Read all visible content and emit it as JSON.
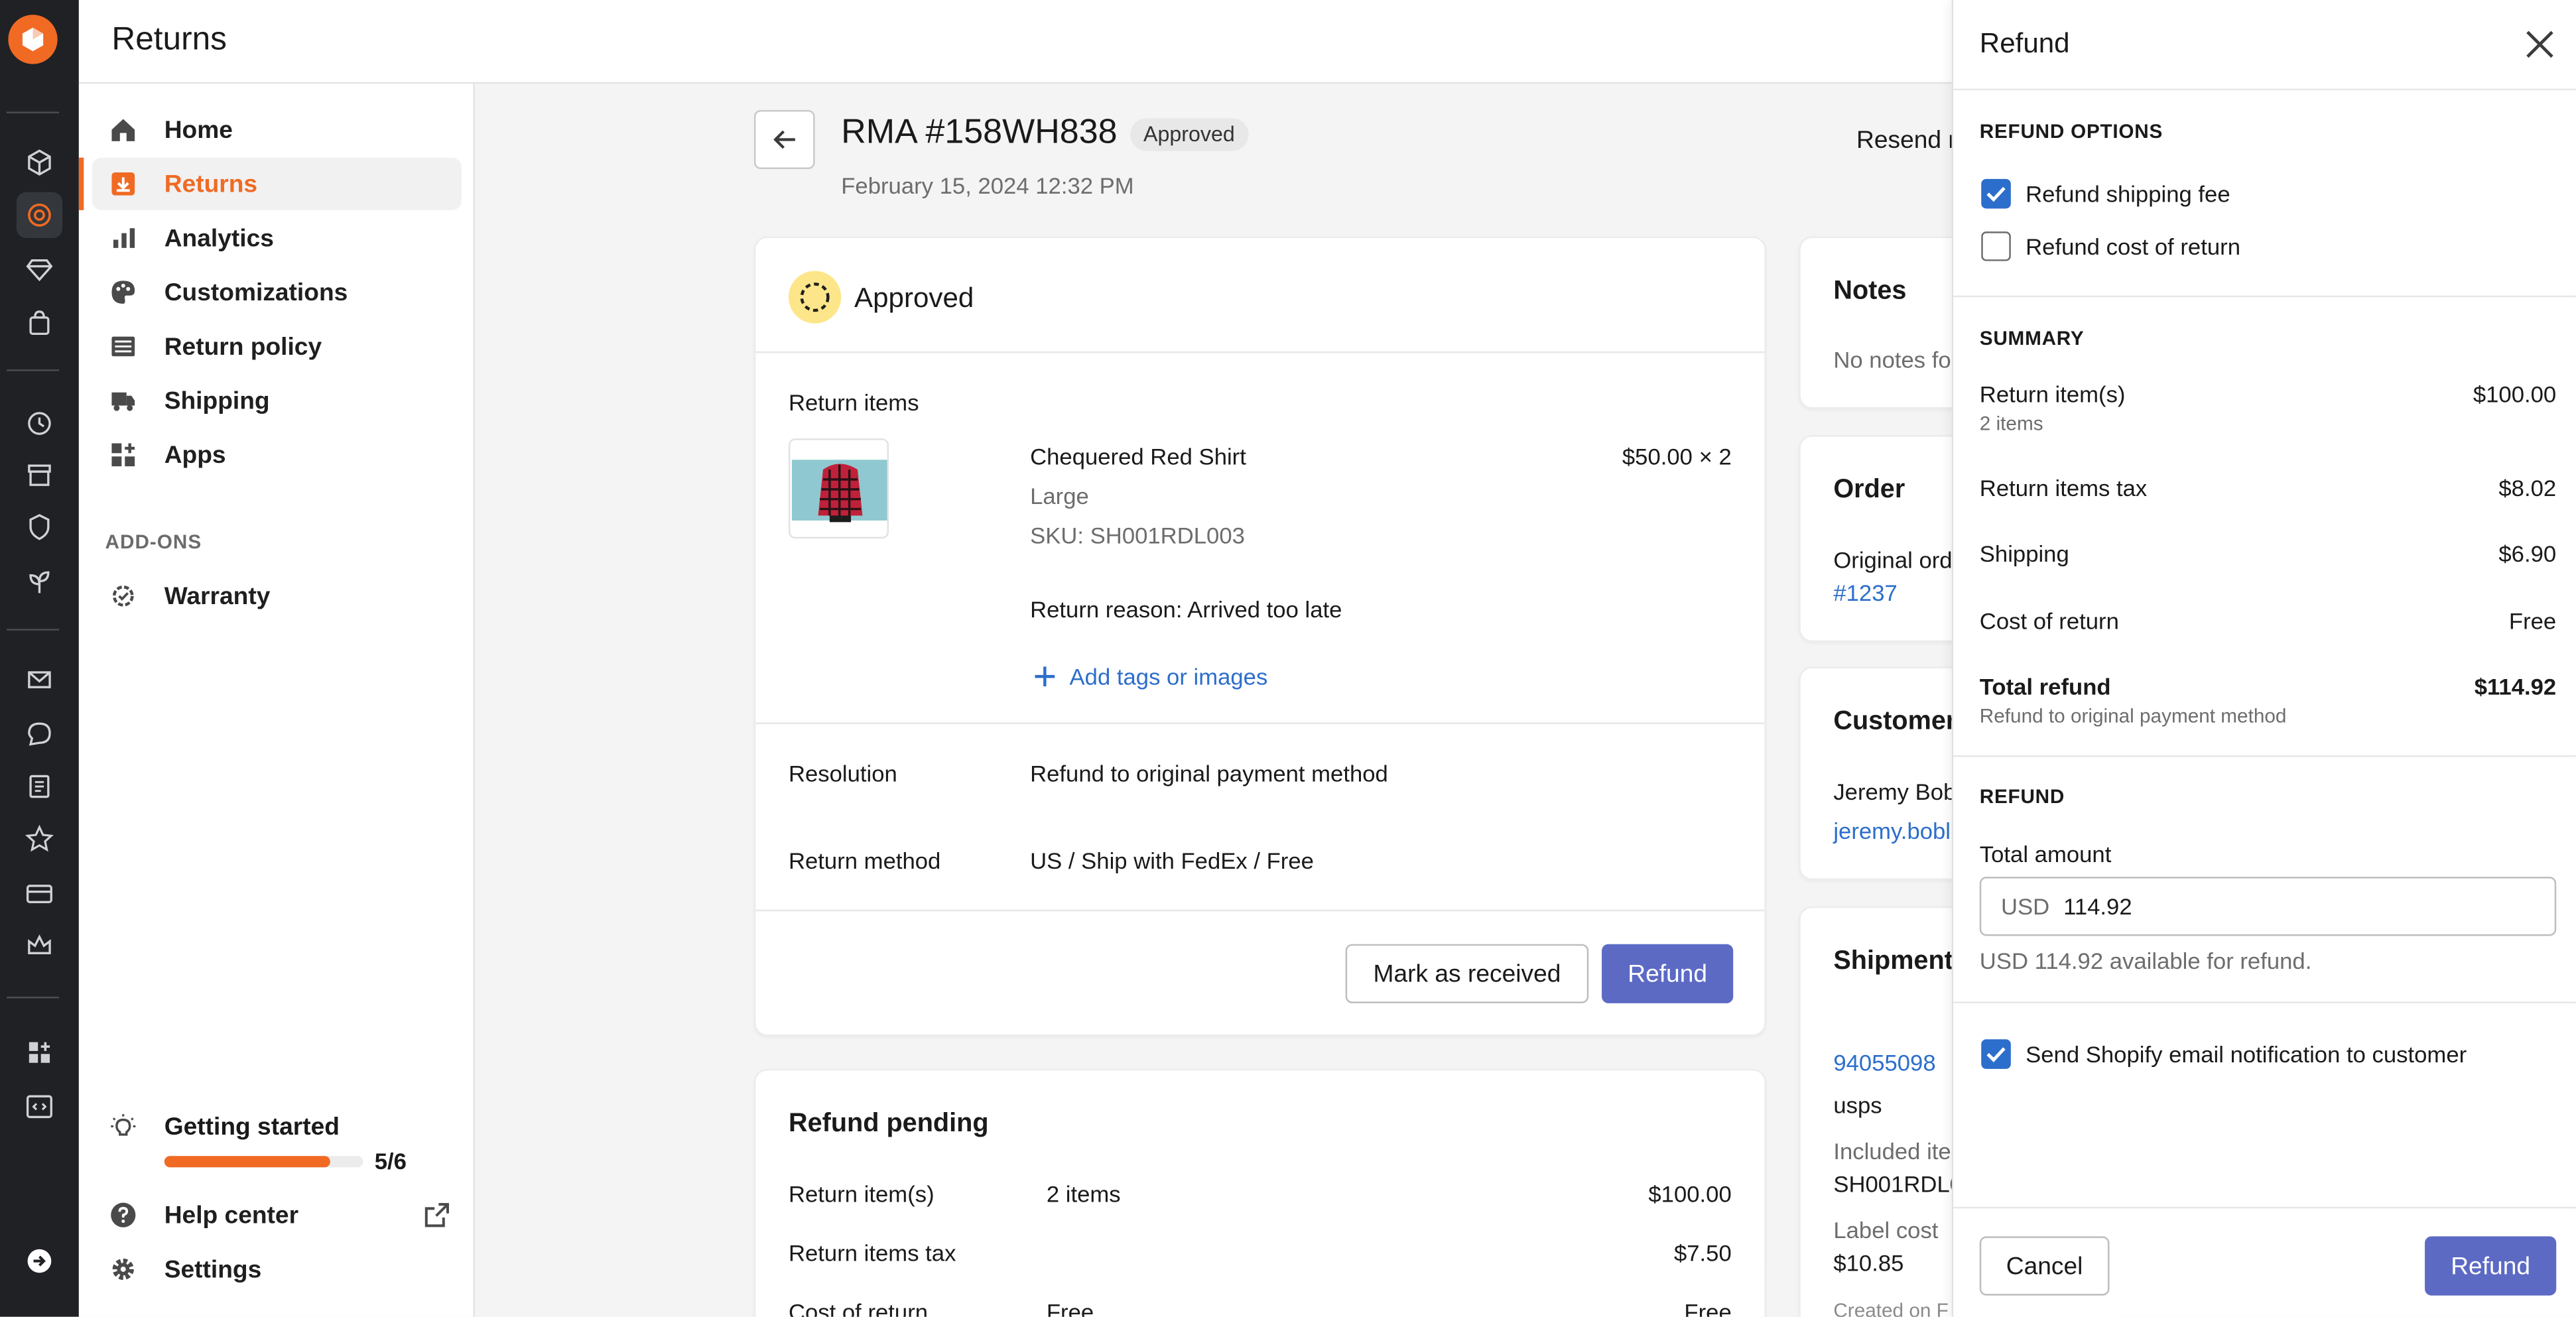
{
  "app": {
    "title": "Returns"
  },
  "sidebar": {
    "items": [
      {
        "label": "Home",
        "icon": "home-icon"
      },
      {
        "label": "Returns",
        "icon": "returns-icon",
        "active": true
      },
      {
        "label": "Analytics",
        "icon": "bar-chart-icon"
      },
      {
        "label": "Customizations",
        "icon": "palette-icon"
      },
      {
        "label": "Return policy",
        "icon": "list-icon"
      },
      {
        "label": "Shipping",
        "icon": "truck-icon"
      },
      {
        "label": "Apps",
        "icon": "apps-icon"
      }
    ],
    "addons_heading": "ADD-ONS",
    "addons": [
      {
        "label": "Warranty",
        "icon": "gear-badge-icon"
      }
    ],
    "getting_started": {
      "label": "Getting started",
      "progress": "5/6",
      "fraction": 0.8333
    },
    "help_center": "Help center",
    "settings": "Settings"
  },
  "rma": {
    "title": "RMA #158WH838",
    "status_badge": "Approved",
    "date": "February 15, 2024 12:32 PM",
    "resend_label": "Resend r"
  },
  "approved_card": {
    "heading": "Approved",
    "return_items_label": "Return items",
    "item": {
      "name": "Chequered Red Shirt",
      "variant": "Large",
      "sku": "SKU: SH001RDL003",
      "price": "$50.00 × 2",
      "reason": "Return reason: Arrived too late"
    },
    "add_tags": "Add tags or images",
    "resolution_label": "Resolution",
    "resolution_value": "Refund to original payment method",
    "return_method_label": "Return method",
    "return_method_value": "US / Ship with FedEx / Free",
    "mark_received": "Mark as received",
    "refund": "Refund"
  },
  "refund_pending": {
    "heading": "Refund pending",
    "rows": [
      {
        "label": "Return item(s)",
        "mid": "2 items",
        "value": "$100.00"
      },
      {
        "label": "Return items tax",
        "mid": "",
        "value": "$7.50"
      },
      {
        "label": "Cost of return",
        "mid": "Free",
        "value": "Free"
      }
    ]
  },
  "right_column": {
    "notes_heading": "Notes",
    "notes_text": "No notes fo",
    "order_heading": "Order",
    "order_text": "Original ord",
    "order_link": "#1237",
    "customer_heading": "Customer",
    "customer_name": "Jeremy Bob",
    "customer_email": "jeremy.bobl",
    "shipment_heading": "Shipment",
    "tracking": "94055098",
    "carrier": "usps",
    "included_label": "Included ite",
    "included_value": "SH001RDL0",
    "label_cost_label": "Label cost",
    "label_cost_value": "$10.85",
    "created_on": "Created on F"
  },
  "drawer": {
    "title": "Refund",
    "options_heading": "REFUND OPTIONS",
    "opt_shipping": "Refund shipping fee",
    "opt_shipping_checked": true,
    "opt_cost": "Refund cost of return",
    "opt_cost_checked": false,
    "summary_heading": "SUMMARY",
    "summary": {
      "return_items_label": "Return item(s)",
      "return_items_sub": "2 items",
      "return_items_value": "$100.00",
      "tax_label": "Return items tax",
      "tax_value": "$8.02",
      "shipping_label": "Shipping",
      "shipping_value": "$6.90",
      "cost_label": "Cost of return",
      "cost_value": "Free",
      "total_label": "Total refund",
      "total_sub": "Refund to original payment method",
      "total_value": "$114.92"
    },
    "refund_heading": "REFUND",
    "total_amount_label": "Total amount",
    "currency": "USD",
    "amount": "114.92",
    "available": "USD 114.92 available for refund.",
    "notify": "Send Shopify email notification to customer",
    "notify_checked": true,
    "cancel": "Cancel",
    "refund": "Refund"
  },
  "colors": {
    "accent": "#f06a24",
    "primary": "#5c6ac4",
    "link": "#2c6ecb",
    "rail": "#1f2124"
  }
}
